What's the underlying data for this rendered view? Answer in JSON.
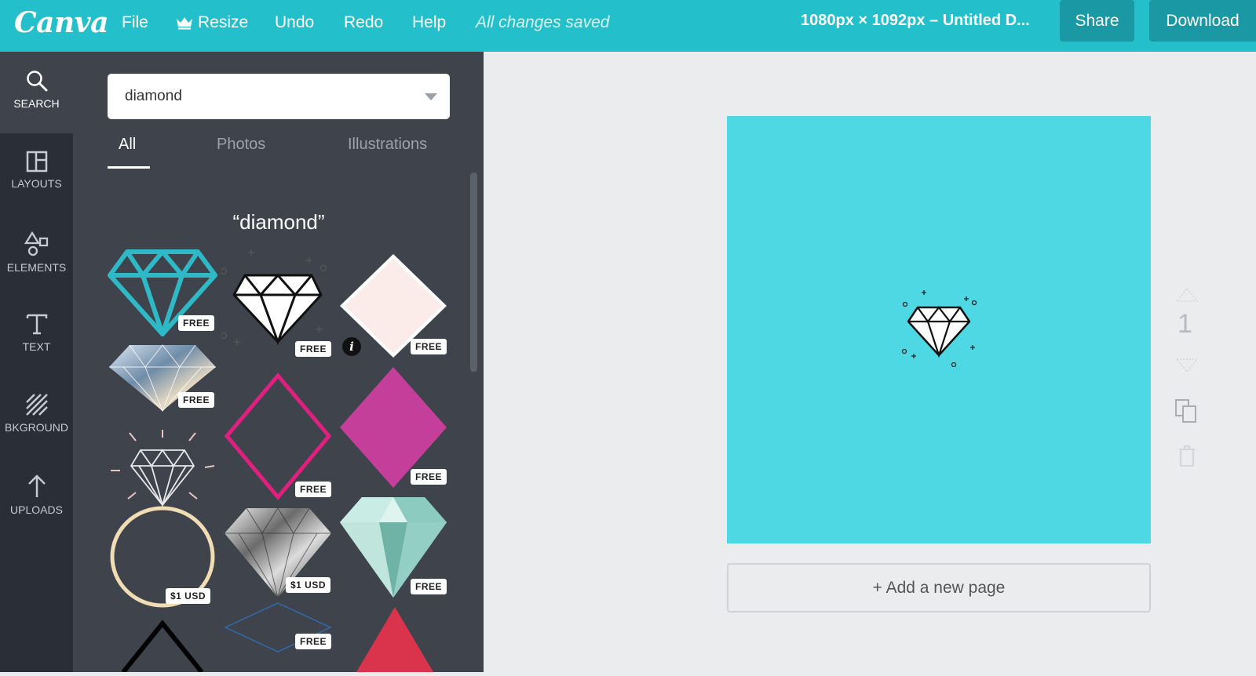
{
  "app": {
    "logo": "Canva",
    "menu": {
      "file": "File",
      "resize": "Resize",
      "undo": "Undo",
      "redo": "Redo",
      "help": "Help"
    },
    "save_status": "All changes saved",
    "document_title": "1080px × 1092px – Untitled D...",
    "share_label": "Share",
    "download_label": "Download"
  },
  "rail": {
    "items": [
      {
        "label": "SEARCH",
        "icon": "search-icon",
        "active": true
      },
      {
        "label": "LAYOUTS",
        "icon": "layouts-icon"
      },
      {
        "label": "ELEMENTS",
        "icon": "elements-icon"
      },
      {
        "label": "TEXT",
        "icon": "text-icon"
      },
      {
        "label": "BKGROUND",
        "icon": "background-icon"
      },
      {
        "label": "UPLOADS",
        "icon": "upload-icon"
      }
    ]
  },
  "panel": {
    "search_value": "diamond",
    "tabs": [
      "All",
      "Photos",
      "Illustrations"
    ],
    "active_tab": "All",
    "result_title": "“diamond”",
    "results": [
      {
        "badge": "FREE"
      },
      {
        "badge": "FREE"
      },
      {
        "badge": "FREE"
      },
      {
        "badge": "FREE"
      },
      {
        "badge": "FREE"
      },
      {
        "badge": "FREE"
      },
      {
        "badge": "$1 USD"
      },
      {
        "badge": "$1 USD"
      },
      {
        "badge": "FREE"
      },
      {
        "badge": "FREE"
      }
    ],
    "info_glyph": "i"
  },
  "canvas": {
    "background": "#4dd8e4",
    "page_number": "1",
    "add_page_label": "+ Add a new page"
  },
  "colors": {
    "brand": "#23c0cc",
    "button": "#1a98a3",
    "panel": "#3e434c",
    "rail": "#2a2e36"
  }
}
